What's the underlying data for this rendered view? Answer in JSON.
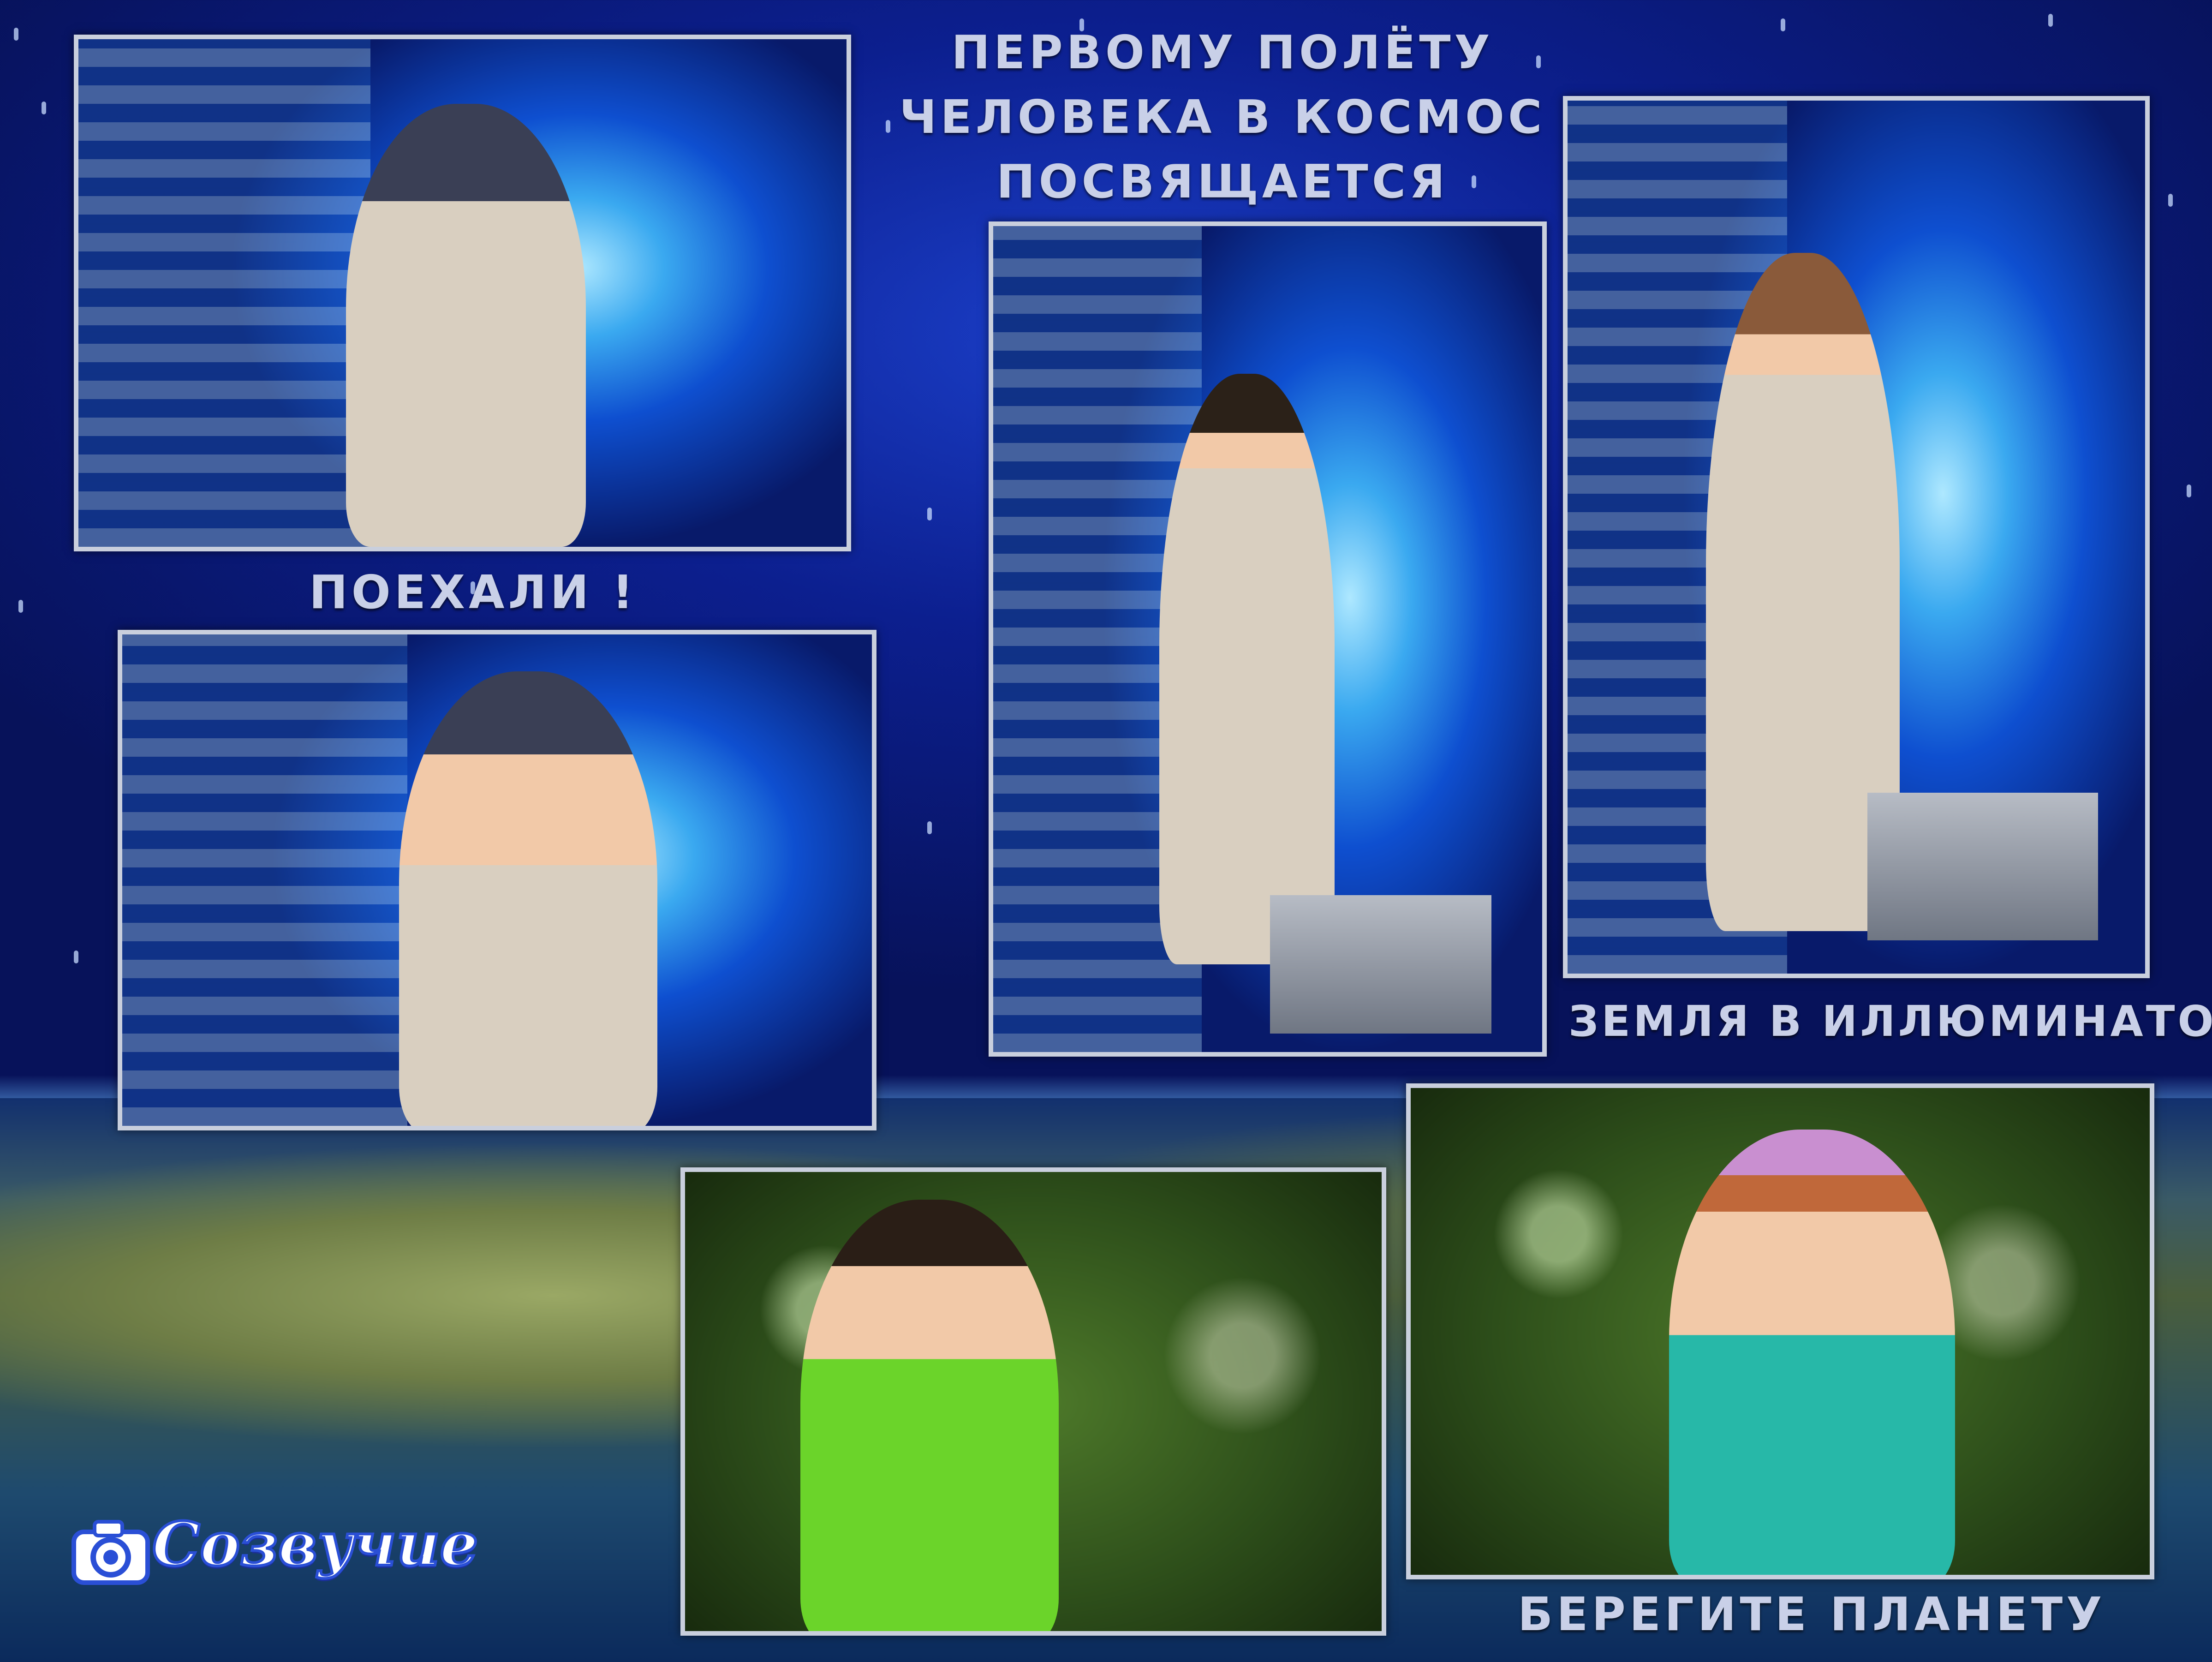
{
  "title": {
    "line1": "Первому полёту",
    "line2": "человека в космос",
    "line3": "посвящается"
  },
  "captions": {
    "poekhali": "Поехали !",
    "zemlya": "Земля в иллюминаторе",
    "beregite": "Берегите планету"
  },
  "logo": {
    "text": "Созвучие",
    "icon": "camera-icon"
  }
}
